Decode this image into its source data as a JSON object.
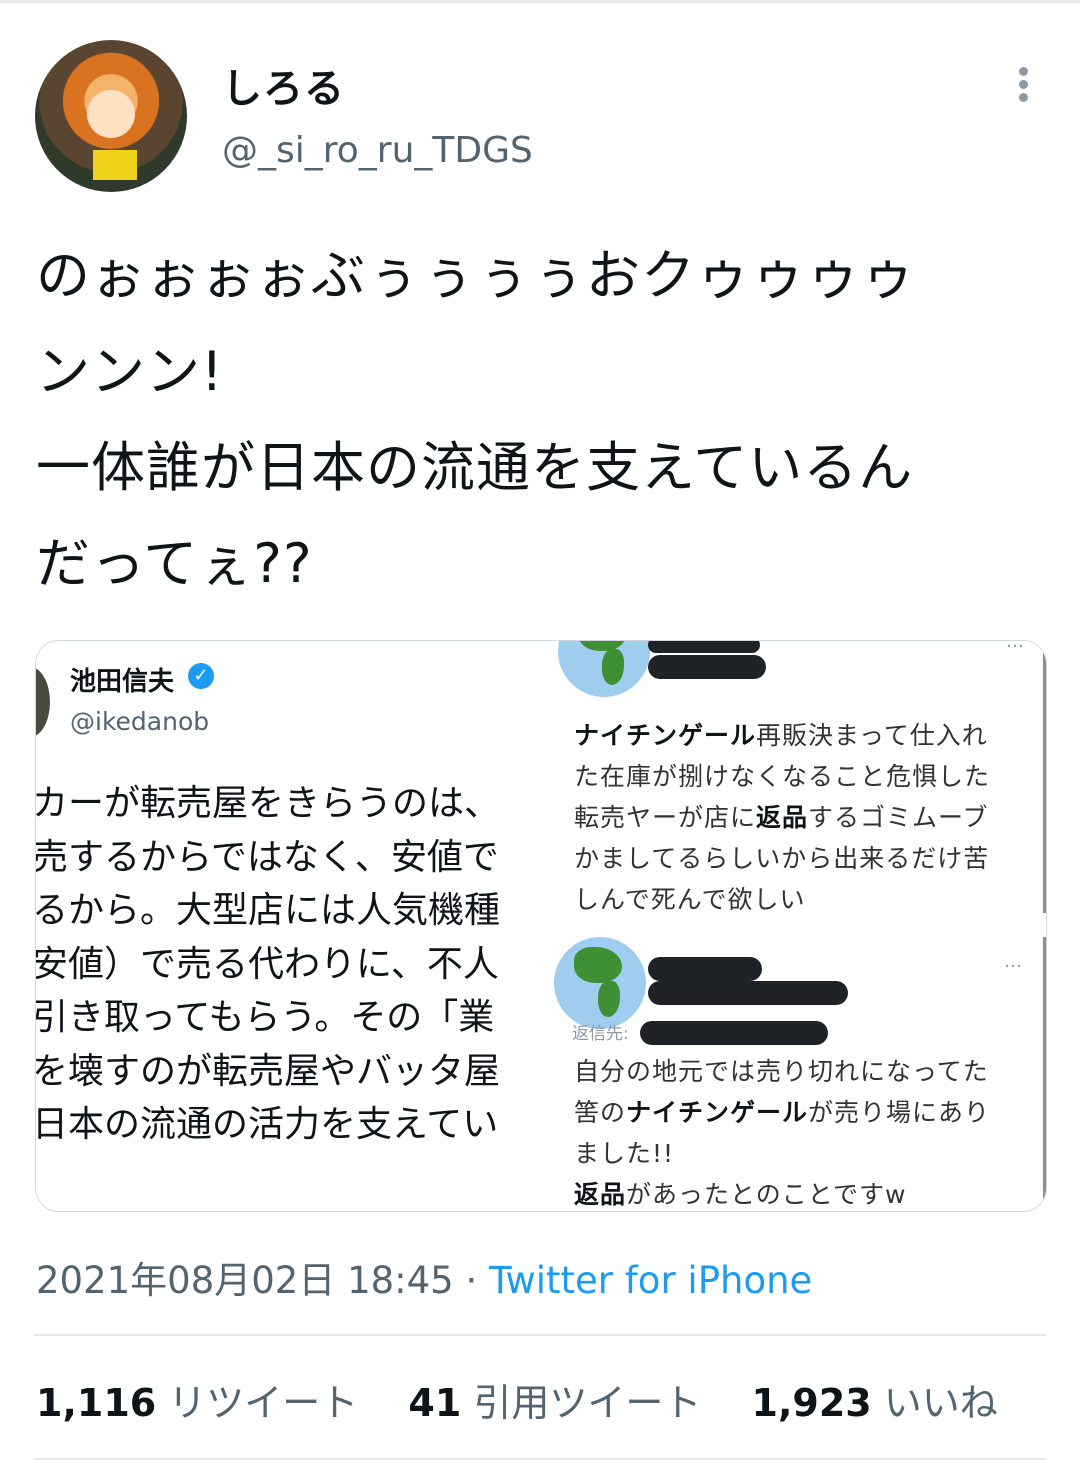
{
  "user": {
    "display_name": "しろる",
    "handle": "@_si_ro_ru_TDGS"
  },
  "tweet": {
    "text_lines": [
      "のぉぉぉぉぶぅぅぅぅおクゥゥゥゥ",
      "ンンン!",
      "一体誰が日本の流通を支えているん",
      "だってぇ??"
    ]
  },
  "media": {
    "left_image": {
      "name": "池田信夫",
      "verified_glyph": "✓",
      "handle": "@ikedanob",
      "lines": [
        "カーが転売屋をきらうのは、",
        "売するからではなく、安値で",
        "るから。大型店には人気機種",
        "安値）で売る代わりに、不人",
        "引き取ってもらう。その「業",
        "を壊すのが転売屋やバッタ屋",
        "日本の流通の活力を支えてい"
      ]
    },
    "top_right_image": {
      "more": "…",
      "bold_1": "ナイチンゲール",
      "text_1": "再販決まって仕入れ",
      "line_2": "た在庫が捌けなくなること危惧した",
      "text_3a": "転売ヤーが店に",
      "bold_3": "返品",
      "text_3b": "するゴミムーブ",
      "line_4": "かましてるらしいから出来るだけ苦",
      "line_5": "しんで死んで欲しい"
    },
    "bottom_right_image": {
      "more": "…",
      "reply_label": "返信先:",
      "line_1": "自分の地元では売り切れになってた",
      "text_2a": "筈の",
      "bold_2": "ナイチンゲール",
      "text_2b": "が売り場にあり",
      "line_3": "ました!!",
      "bold_4": "返品",
      "text_4": "があったとのことですw"
    }
  },
  "meta": {
    "timestamp": "2021年08月02日 18:45",
    "separator": " · ",
    "source": "Twitter for iPhone"
  },
  "stats": {
    "retweets": "1,116",
    "retweets_label": "リツイート",
    "quotes": "41",
    "quotes_label": "引用ツイート",
    "likes": "1,923",
    "likes_label": "いいね"
  },
  "colors": {
    "link_blue": "#1d9bf0",
    "secondary_text": "#536471",
    "divider": "#e7e9ea"
  }
}
